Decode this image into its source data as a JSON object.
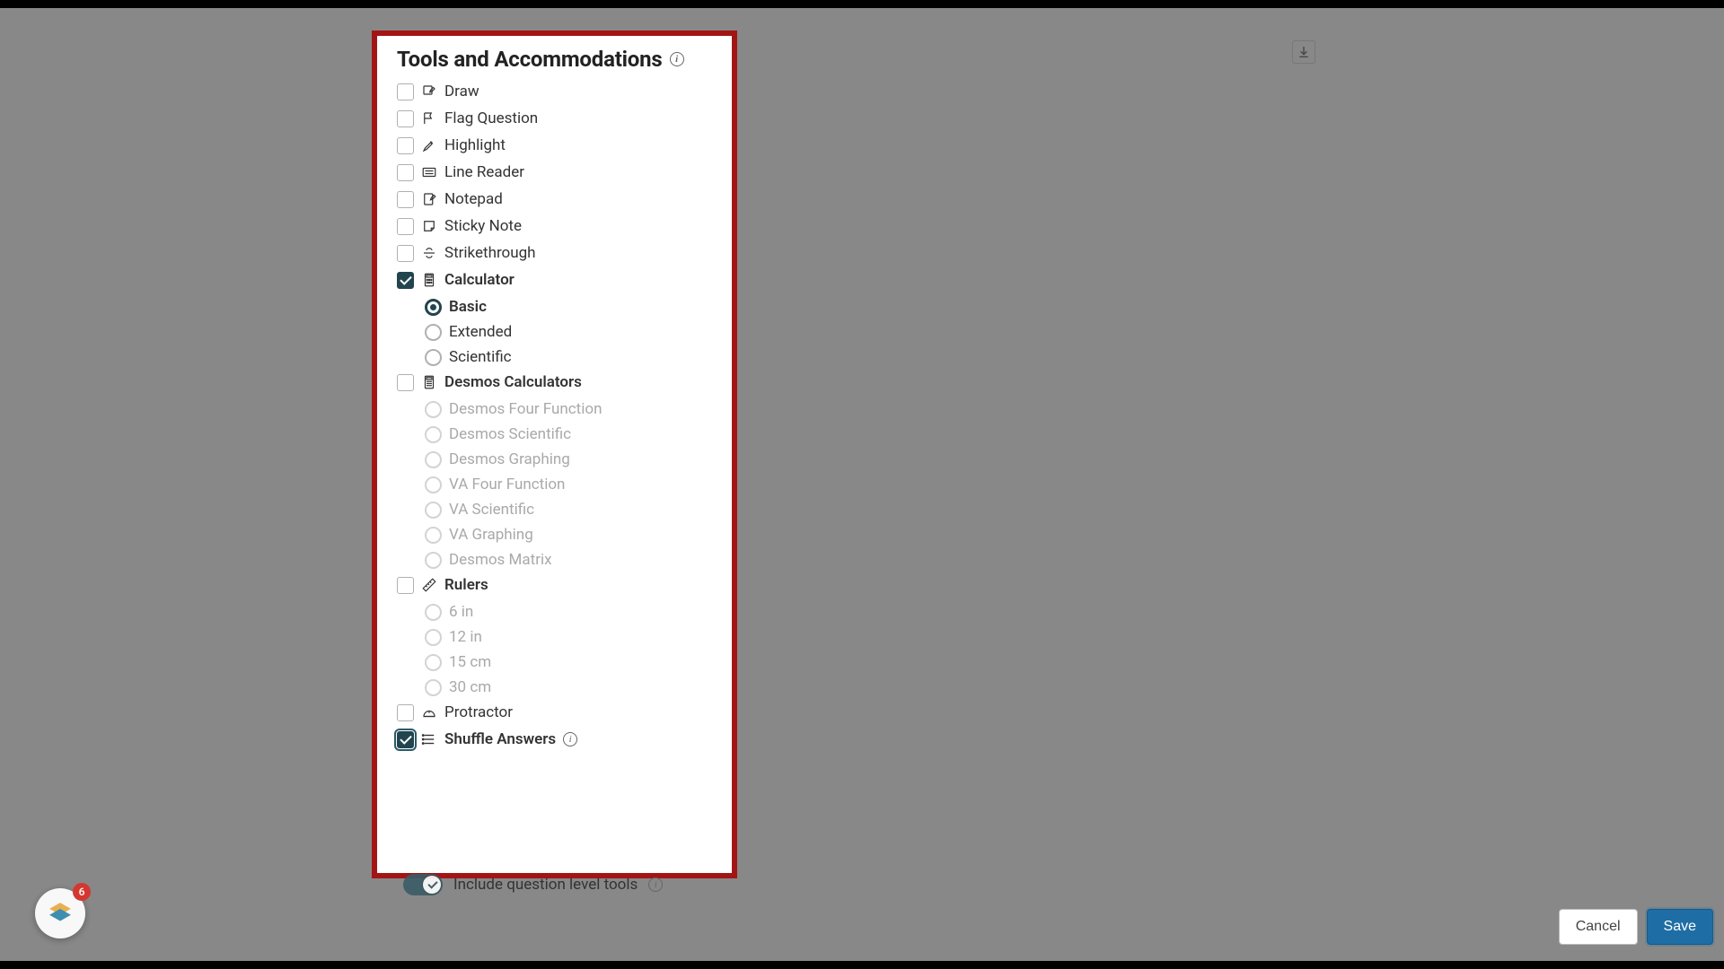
{
  "panel": {
    "title": "Tools and Accommodations"
  },
  "tools": {
    "draw": {
      "label": "Draw",
      "checked": false
    },
    "flag": {
      "label": "Flag Question",
      "checked": false
    },
    "highlight": {
      "label": "Highlight",
      "checked": false
    },
    "linereader": {
      "label": "Line Reader",
      "checked": false
    },
    "notepad": {
      "label": "Notepad",
      "checked": false
    },
    "sticky": {
      "label": "Sticky Note",
      "checked": false
    },
    "strike": {
      "label": "Strikethrough",
      "checked": false
    },
    "calculator": {
      "label": "Calculator",
      "checked": true,
      "options": [
        {
          "label": "Basic",
          "selected": true
        },
        {
          "label": "Extended",
          "selected": false
        },
        {
          "label": "Scientific",
          "selected": false
        }
      ]
    },
    "desmos": {
      "label": "Desmos Calculators",
      "checked": false,
      "disabled_options": [
        "Desmos Four Function",
        "Desmos Scientific",
        "Desmos Graphing",
        "VA Four Function",
        "VA Scientific",
        "VA Graphing",
        "Desmos Matrix"
      ]
    },
    "rulers": {
      "label": "Rulers",
      "checked": false,
      "disabled_options": [
        "6 in",
        "12 in",
        "15 cm",
        "30 cm"
      ]
    },
    "protractor": {
      "label": "Protractor",
      "checked": false
    },
    "shuffle": {
      "label": "Shuffle Answers",
      "checked": true
    }
  },
  "below": {
    "include_tools": "Include question level tools",
    "toggle_on": true
  },
  "footer": {
    "cancel": "Cancel",
    "save": "Save"
  },
  "floating": {
    "badge": "6"
  }
}
